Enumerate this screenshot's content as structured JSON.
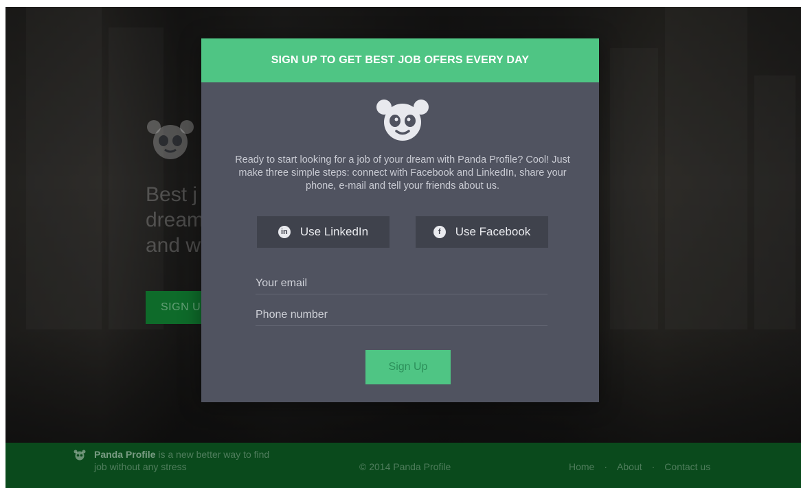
{
  "colors": {
    "accent": "#4fc584",
    "modal_bg": "#505360",
    "social_btn_bg": "#3f424c",
    "footer_bg": "#0a4a1c"
  },
  "hero": {
    "logo_icon": "panda-icon",
    "title": "Best j\ndream\nand w",
    "cta_label": "SIGN U"
  },
  "modal": {
    "header": "SIGN UP TO GET BEST JOB OFERS EVERY DAY",
    "logo_icon": "panda-icon",
    "description": "Ready to start looking for a job of your dream with Panda Profile? Cool! Just make three simple steps: connect with Facebook and LinkedIn, share your phone, e-mail and tell your friends about us.",
    "linkedin": {
      "label": "Use LinkedIn",
      "icon": "linkedin-icon",
      "glyph": "in"
    },
    "facebook": {
      "label": "Use Facebook",
      "icon": "facebook-icon",
      "glyph": "f"
    },
    "email_placeholder": "Your email",
    "phone_placeholder": "Phone number",
    "submit_label": "Sign Up"
  },
  "footer": {
    "brand": "Panda Profile",
    "tagline": " is a new better way to find job without any stress",
    "copyright": "© 2014 Panda Profile",
    "nav": [
      "Home",
      "About",
      "Contact us"
    ],
    "separator": "·"
  }
}
